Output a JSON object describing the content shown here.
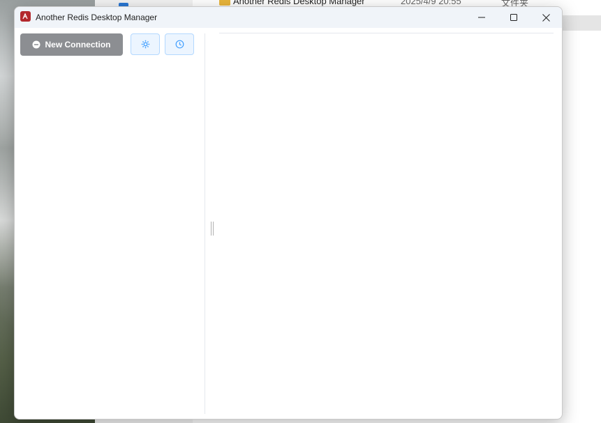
{
  "background": {
    "explorer_row": {
      "name": "Another Redis Desktop Manager",
      "date": "2025/4/9 20:55",
      "type": "文件夹"
    }
  },
  "window": {
    "title": "Another Redis Desktop Manager",
    "controls": {
      "minimize_icon": "minimize-icon",
      "maximize_icon": "maximize-icon",
      "close_icon": "close-icon"
    }
  },
  "toolbar": {
    "new_connection_label": "New Connection",
    "settings_icon": "gear-icon",
    "history_icon": "clock-icon"
  },
  "colors": {
    "new_connection_bg": "#8c8e92",
    "icon_button_bg": "#ecf5ff",
    "icon_button_border": "#b3d8ff",
    "icon_accent": "#409eff",
    "titlebar_bg": "#f0f4f9"
  }
}
